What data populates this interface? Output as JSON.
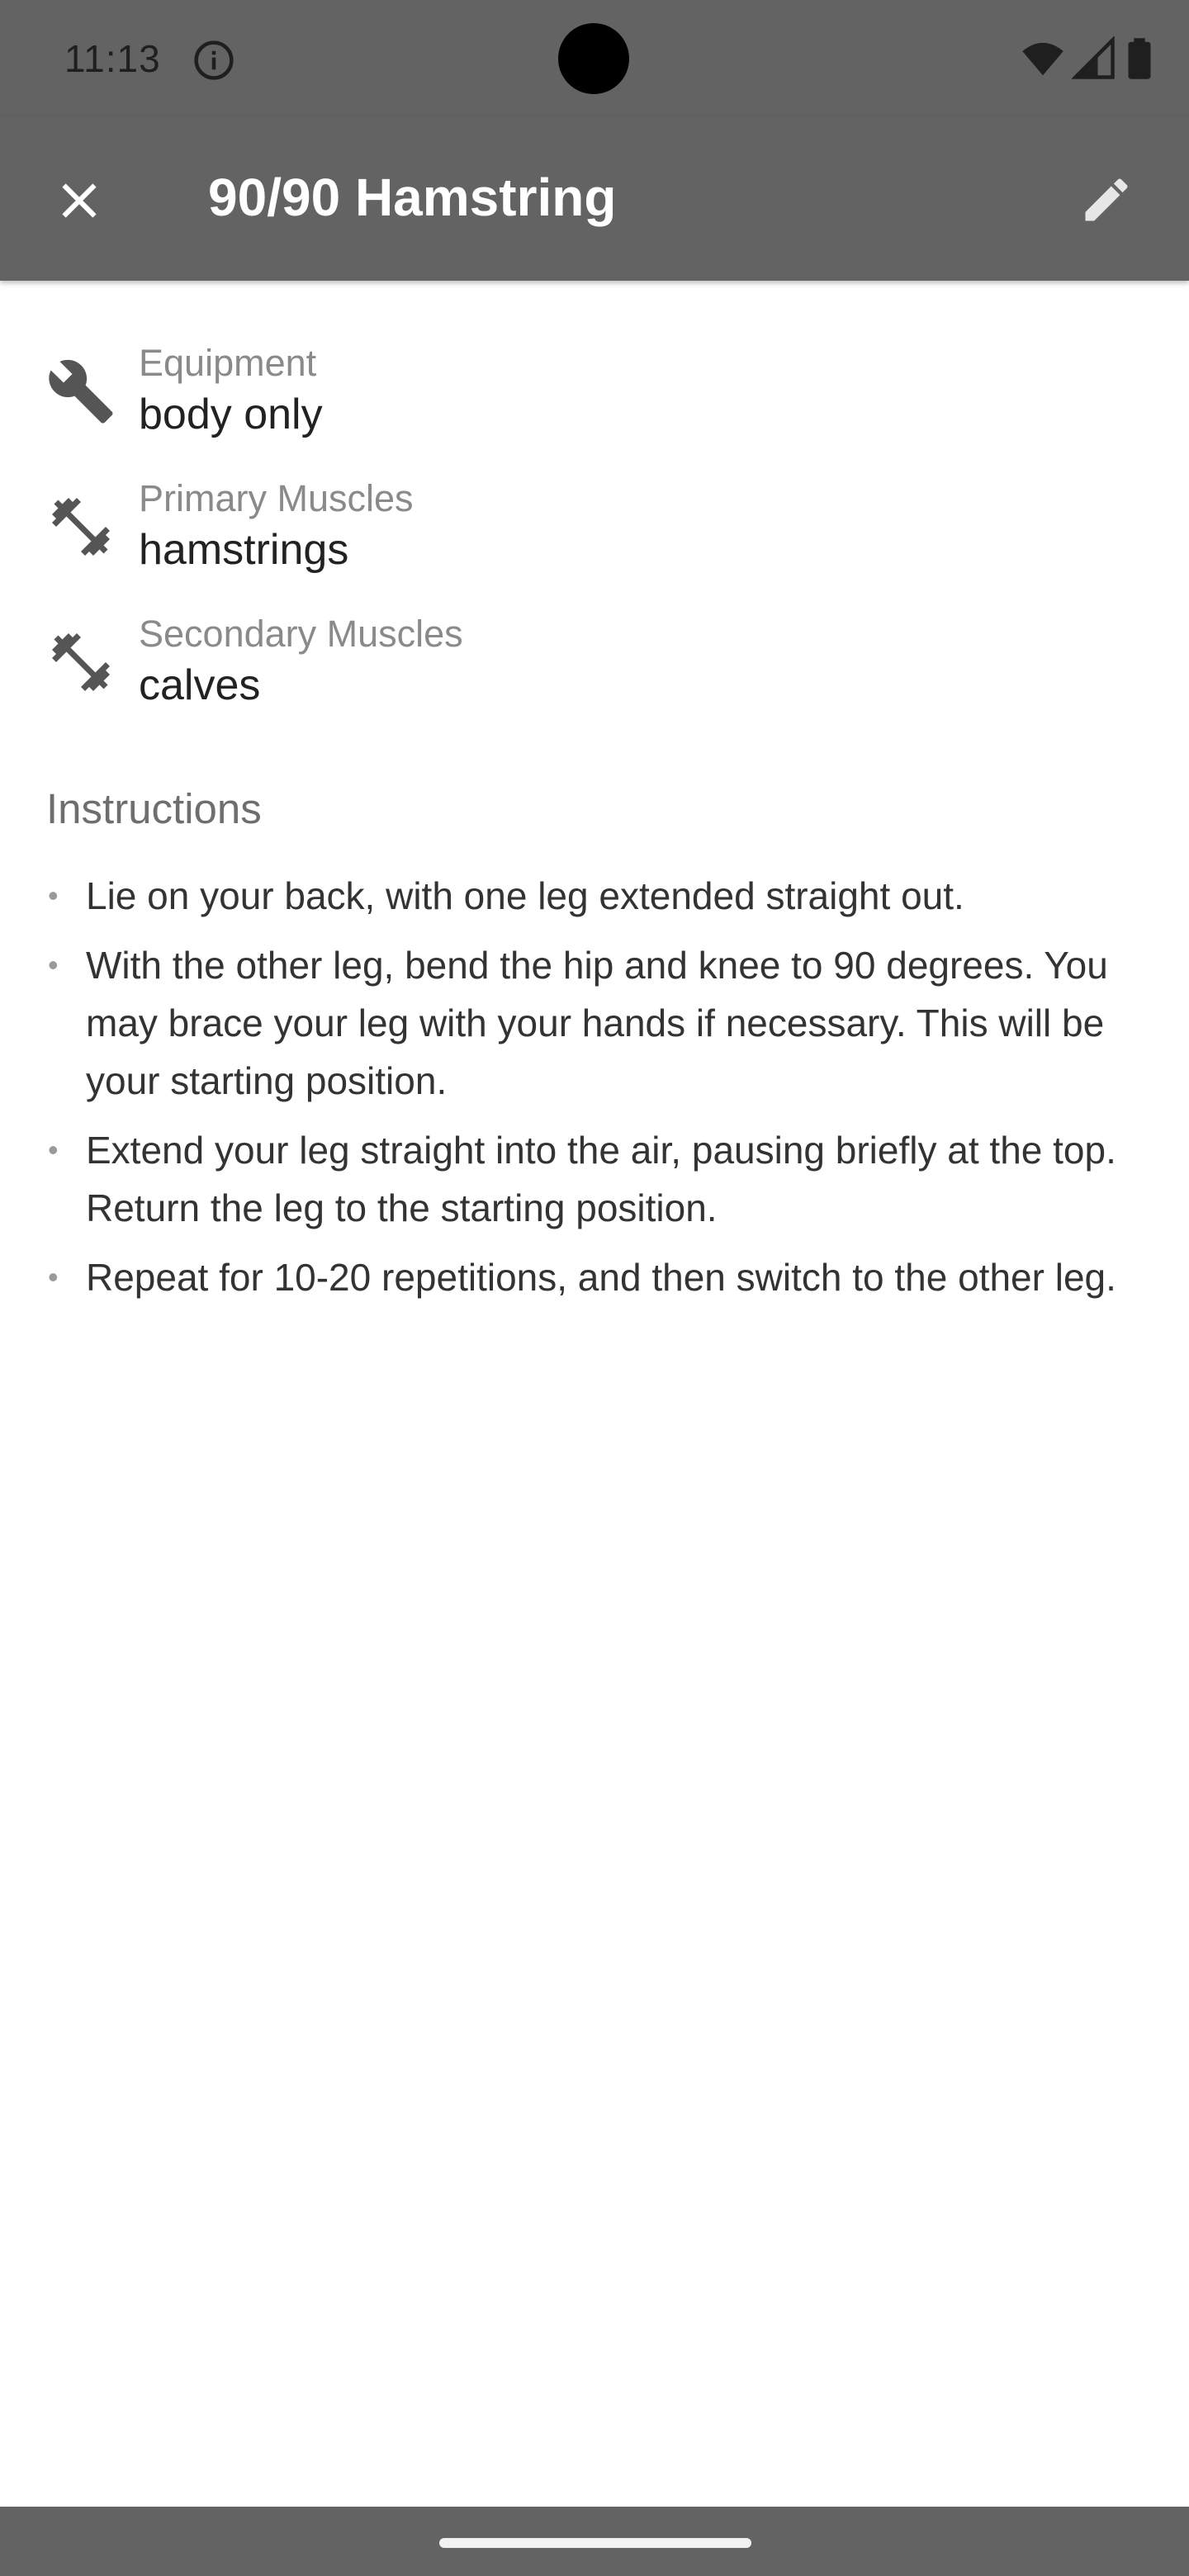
{
  "status_bar": {
    "time": "11:13",
    "icons": [
      "info-icon",
      "wifi-icon",
      "signal-icon",
      "battery-icon"
    ]
  },
  "app_bar": {
    "title": "90/90 Hamstring",
    "close_icon": "close-icon",
    "edit_icon": "edit-pencil-icon"
  },
  "details": [
    {
      "label": "Equipment",
      "value": "body only",
      "icon": "wrench-icon"
    },
    {
      "label": "Primary Muscles",
      "value": "hamstrings",
      "icon": "dumbbell-icon"
    },
    {
      "label": "Secondary Muscles",
      "value": "calves",
      "icon": "dumbbell-icon"
    }
  ],
  "instructions": {
    "heading": "Instructions",
    "steps": [
      "Lie on your back, with one leg extended straight out.",
      "With the other leg, bend the hip and knee to 90 degrees. You may brace your leg with your hands if necessary. This will be your starting position.",
      "Extend your leg straight into the air, pausing briefly at the top. Return the leg to the starting position.",
      "Repeat for 10-20 repetitions, and then switch to the other leg."
    ]
  },
  "colors": {
    "app_bar": "#636363",
    "background": "#ffffff",
    "label_gray": "#8a8a8a",
    "text_dark": "#222222"
  }
}
